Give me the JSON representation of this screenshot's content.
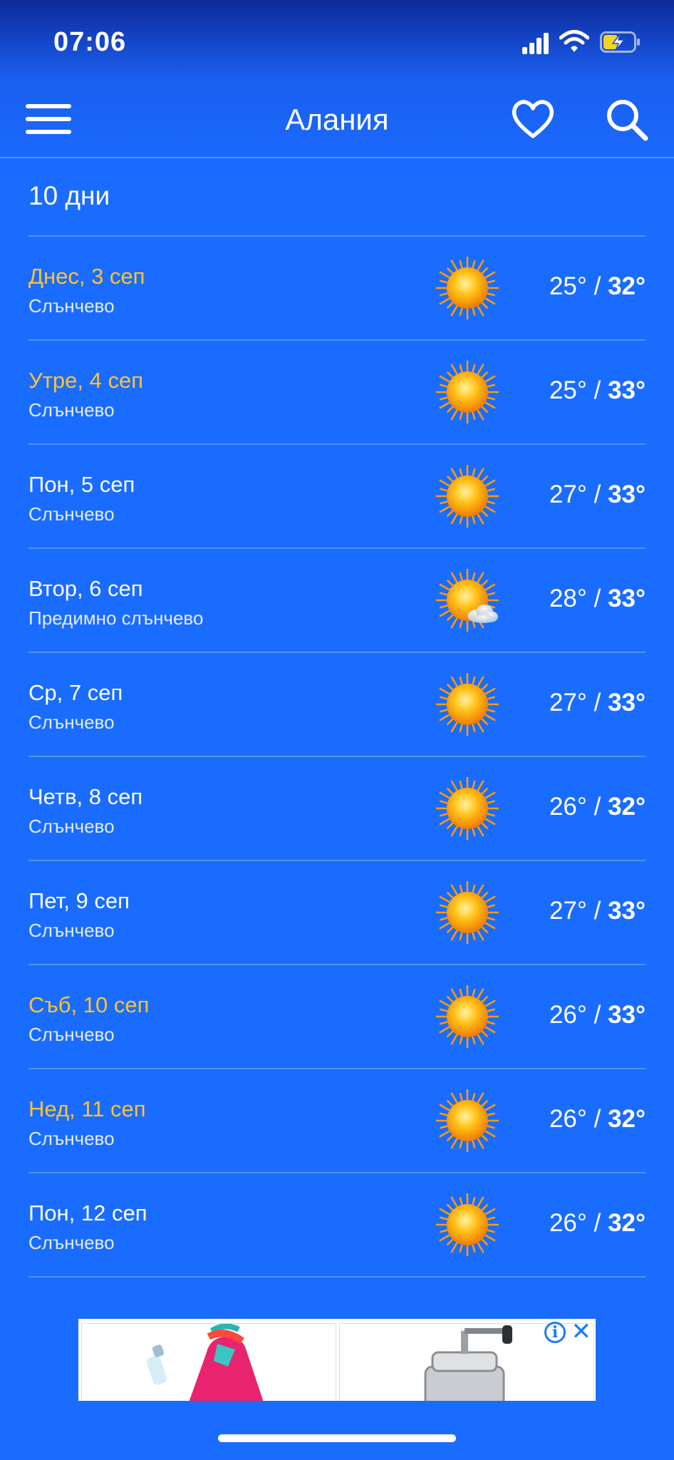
{
  "status": {
    "time": "07:06"
  },
  "app": {
    "title": "Алания"
  },
  "section": {
    "title": "10 дни"
  },
  "colors": {
    "background": "#1a6cff",
    "weekend_day": "#ffc330",
    "sun": "#ffb400"
  },
  "days": [
    {
      "day": "Днес, 3 сеп",
      "condition": "Слънчево",
      "low": "25°",
      "high": "32°",
      "icon": "sun-icon",
      "highlight": true
    },
    {
      "day": "Утре, 4 сеп",
      "condition": "Слънчево",
      "low": "25°",
      "high": "33°",
      "icon": "sun-icon",
      "highlight": true
    },
    {
      "day": "Пон, 5 сеп",
      "condition": "Слънчево",
      "low": "27°",
      "high": "33°",
      "icon": "sun-icon",
      "highlight": false
    },
    {
      "day": "Втор, 6 сеп",
      "condition": "Предимно слънчево",
      "low": "28°",
      "high": "33°",
      "icon": "sun-cloud-icon",
      "highlight": false
    },
    {
      "day": "Ср, 7 сеп",
      "condition": "Слънчево",
      "low": "27°",
      "high": "33°",
      "icon": "sun-icon",
      "highlight": false
    },
    {
      "day": "Четв, 8 сеп",
      "condition": "Слънчево",
      "low": "26°",
      "high": "32°",
      "icon": "sun-icon",
      "highlight": false
    },
    {
      "day": "Пет, 9 сеп",
      "condition": "Слънчево",
      "low": "27°",
      "high": "33°",
      "icon": "sun-icon",
      "highlight": false
    },
    {
      "day": "Съб, 10 сеп",
      "condition": "Слънчево",
      "low": "26°",
      "high": "33°",
      "icon": "sun-icon",
      "highlight": true
    },
    {
      "day": "Нед, 11 сеп",
      "condition": "Слънчево",
      "low": "26°",
      "high": "32°",
      "icon": "sun-icon",
      "highlight": true
    },
    {
      "day": "Пон, 12 сеп",
      "condition": "Слънчево",
      "low": "26°",
      "high": "32°",
      "icon": "sun-icon",
      "highlight": false
    }
  ],
  "ad": {
    "info_glyph": "i",
    "close_glyph": "✕"
  }
}
